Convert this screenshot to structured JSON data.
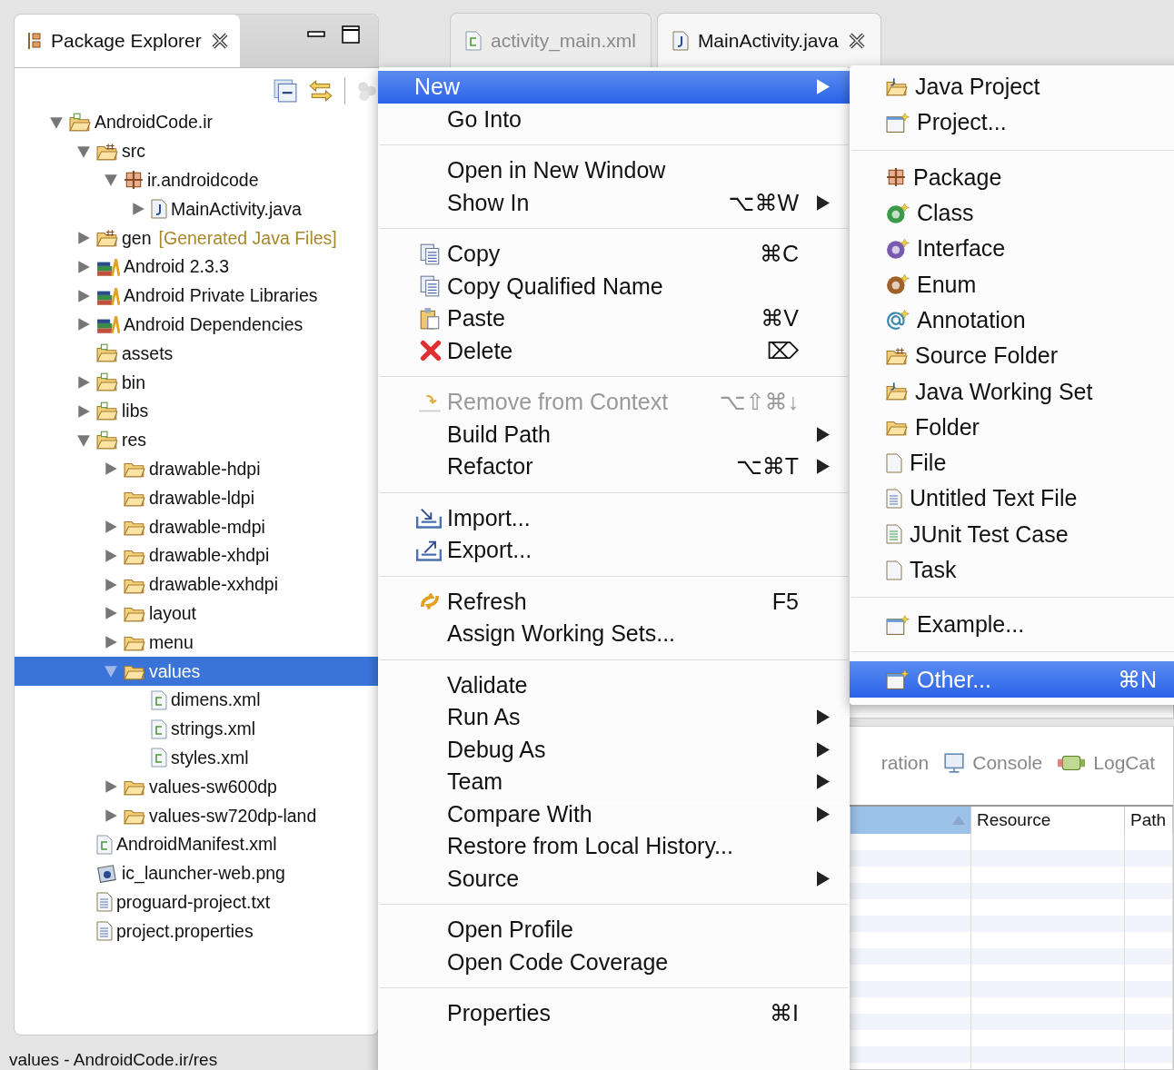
{
  "package_explorer": {
    "title": "Package Explorer",
    "tree": [
      {
        "label": "AndroidCode.ir",
        "kind": "project",
        "expanded": true,
        "selected": false,
        "children": [
          {
            "label": "src",
            "kind": "source",
            "expanded": true,
            "selected": false,
            "children": [
              {
                "label": "ir.androidcode",
                "kind": "package",
                "expanded": true,
                "selected": false,
                "children": [
                  {
                    "label": "MainActivity.java",
                    "kind": "java",
                    "expanded": false,
                    "selected": false
                  }
                ]
              }
            ]
          },
          {
            "label": "gen",
            "suffix": "[Generated Java Files]",
            "kind": "source",
            "expanded": false,
            "selected": false
          },
          {
            "label": "Android 2.3.3",
            "kind": "library",
            "expanded": false,
            "selected": false
          },
          {
            "label": "Android Private Libraries",
            "kind": "library",
            "expanded": false,
            "selected": false
          },
          {
            "label": "Android Dependencies",
            "kind": "library",
            "expanded": false,
            "selected": false
          },
          {
            "label": "assets",
            "kind": "resources",
            "selected": false
          },
          {
            "label": "bin",
            "kind": "resources",
            "expanded": false,
            "selected": false
          },
          {
            "label": "libs",
            "kind": "resources",
            "expanded": false,
            "selected": false
          },
          {
            "label": "res",
            "kind": "resources",
            "expanded": true,
            "selected": false,
            "children": [
              {
                "label": "drawable-hdpi",
                "kind": "folder",
                "expanded": false,
                "selected": false
              },
              {
                "label": "drawable-ldpi",
                "kind": "folder",
                "selected": false
              },
              {
                "label": "drawable-mdpi",
                "kind": "folder",
                "expanded": false,
                "selected": false
              },
              {
                "label": "drawable-xhdpi",
                "kind": "folder",
                "expanded": false,
                "selected": false
              },
              {
                "label": "drawable-xxhdpi",
                "kind": "folder",
                "expanded": false,
                "selected": false
              },
              {
                "label": "layout",
                "kind": "folder",
                "expanded": false,
                "selected": false
              },
              {
                "label": "menu",
                "kind": "folder",
                "expanded": false,
                "selected": false
              },
              {
                "label": "values",
                "kind": "folder",
                "expanded": true,
                "selected": true,
                "children": [
                  {
                    "label": "dimens.xml",
                    "kind": "xml",
                    "selected": false
                  },
                  {
                    "label": "strings.xml",
                    "kind": "xml",
                    "selected": false
                  },
                  {
                    "label": "styles.xml",
                    "kind": "xml",
                    "selected": false
                  }
                ]
              },
              {
                "label": "values-sw600dp",
                "kind": "folder",
                "expanded": false,
                "selected": false
              },
              {
                "label": "values-sw720dp-land",
                "kind": "folder",
                "expanded": false,
                "selected": false
              }
            ]
          },
          {
            "label": "AndroidManifest.xml",
            "kind": "xml",
            "selected": false
          },
          {
            "label": "ic_launcher-web.png",
            "kind": "image",
            "selected": false
          },
          {
            "label": "proguard-project.txt",
            "kind": "text",
            "selected": false
          },
          {
            "label": "project.properties",
            "kind": "text",
            "selected": false
          }
        ]
      }
    ]
  },
  "editor_tabs": [
    {
      "label": "activity_main.xml",
      "kind": "xml",
      "selected": false
    },
    {
      "label": "MainActivity.java",
      "kind": "java",
      "selected": true
    }
  ],
  "context_menu": [
    [
      {
        "label": "New",
        "submenu": true,
        "selected": true,
        "disabled": false
      },
      {
        "label": "Go Into",
        "submenu": false,
        "selected": false,
        "disabled": false
      }
    ],
    [
      {
        "label": "Open in New Window",
        "submenu": false,
        "selected": false,
        "disabled": false
      },
      {
        "label": "Show In",
        "shortcut": "⌥⌘W",
        "submenu": true,
        "selected": false,
        "disabled": false
      }
    ],
    [
      {
        "label": "Copy",
        "kind": "copy",
        "shortcut": "⌘C",
        "submenu": false,
        "selected": false,
        "disabled": false
      },
      {
        "label": "Copy Qualified Name",
        "kind": "copy",
        "submenu": false,
        "selected": false,
        "disabled": false
      },
      {
        "label": "Paste",
        "kind": "paste",
        "shortcut": "⌘V",
        "submenu": false,
        "selected": false,
        "disabled": false
      },
      {
        "label": "Delete",
        "kind": "delete",
        "shortcut": "⌦",
        "submenu": false,
        "selected": false,
        "disabled": false
      }
    ],
    [
      {
        "label": "Remove from Context",
        "kind": "remove",
        "shortcut": "⌥⇧⌘↓",
        "submenu": false,
        "selected": false,
        "disabled": true
      },
      {
        "label": "Build Path",
        "submenu": true,
        "selected": false,
        "disabled": false
      },
      {
        "label": "Refactor",
        "shortcut": "⌥⌘T",
        "submenu": true,
        "selected": false,
        "disabled": false
      }
    ],
    [
      {
        "label": "Import...",
        "kind": "import",
        "submenu": false,
        "selected": false,
        "disabled": false
      },
      {
        "label": "Export...",
        "kind": "export",
        "submenu": false,
        "selected": false,
        "disabled": false
      }
    ],
    [
      {
        "label": "Refresh",
        "kind": "refresh",
        "shortcut": "F5",
        "submenu": false,
        "selected": false,
        "disabled": false
      },
      {
        "label": "Assign Working Sets...",
        "submenu": false,
        "selected": false,
        "disabled": false
      }
    ],
    [
      {
        "label": "Validate",
        "submenu": false,
        "selected": false,
        "disabled": false
      },
      {
        "label": "Run As",
        "submenu": true,
        "selected": false,
        "disabled": false
      },
      {
        "label": "Debug As",
        "submenu": true,
        "selected": false,
        "disabled": false
      },
      {
        "label": "Team",
        "submenu": true,
        "selected": false,
        "disabled": false
      },
      {
        "label": "Compare With",
        "submenu": true,
        "selected": false,
        "disabled": false
      },
      {
        "label": "Restore from Local History...",
        "submenu": false,
        "selected": false,
        "disabled": false
      },
      {
        "label": "Source",
        "submenu": true,
        "selected": false,
        "disabled": false
      }
    ],
    [
      {
        "label": "Open Profile",
        "submenu": false,
        "selected": false,
        "disabled": false
      },
      {
        "label": "Open Code Coverage",
        "submenu": false,
        "selected": false,
        "disabled": false
      }
    ],
    [
      {
        "label": "Properties",
        "shortcut": "⌘I",
        "submenu": false,
        "selected": false,
        "disabled": false
      }
    ]
  ],
  "new_submenu": [
    [
      {
        "label": "Java Project",
        "kind": "java-project",
        "selected": false
      },
      {
        "label": "Project...",
        "kind": "wizard",
        "selected": false
      }
    ],
    [
      {
        "label": "Package",
        "kind": "package",
        "selected": false
      },
      {
        "label": "Class",
        "kind": "class",
        "selected": false
      },
      {
        "label": "Interface",
        "kind": "interface",
        "selected": false
      },
      {
        "label": "Enum",
        "kind": "enum",
        "selected": false
      },
      {
        "label": "Annotation",
        "kind": "annotation",
        "selected": false
      },
      {
        "label": "Source Folder",
        "kind": "source",
        "selected": false
      },
      {
        "label": "Java Working Set",
        "kind": "java-project",
        "selected": false
      },
      {
        "label": "Folder",
        "kind": "folder",
        "selected": false
      },
      {
        "label": "File",
        "kind": "file",
        "selected": false
      },
      {
        "label": "Untitled Text File",
        "kind": "text",
        "selected": false
      },
      {
        "label": "JUnit Test Case",
        "kind": "junit",
        "selected": false
      },
      {
        "label": "Task",
        "kind": "file",
        "selected": false
      }
    ],
    [
      {
        "label": "Example...",
        "kind": "wizard",
        "selected": false
      }
    ],
    [
      {
        "label": "Other...",
        "kind": "wizard",
        "shortcut": "⌘N",
        "selected": true
      }
    ]
  ],
  "bottom_view": {
    "tabs": [
      {
        "label": "ration",
        "kind": "none"
      },
      {
        "label": "Console",
        "kind": "console"
      },
      {
        "label": "LogCat",
        "kind": "logcat"
      }
    ],
    "columns": [
      {
        "label": "Resource"
      },
      {
        "label": "Path"
      }
    ]
  },
  "status_bar": "values - AndroidCode.ir/res"
}
